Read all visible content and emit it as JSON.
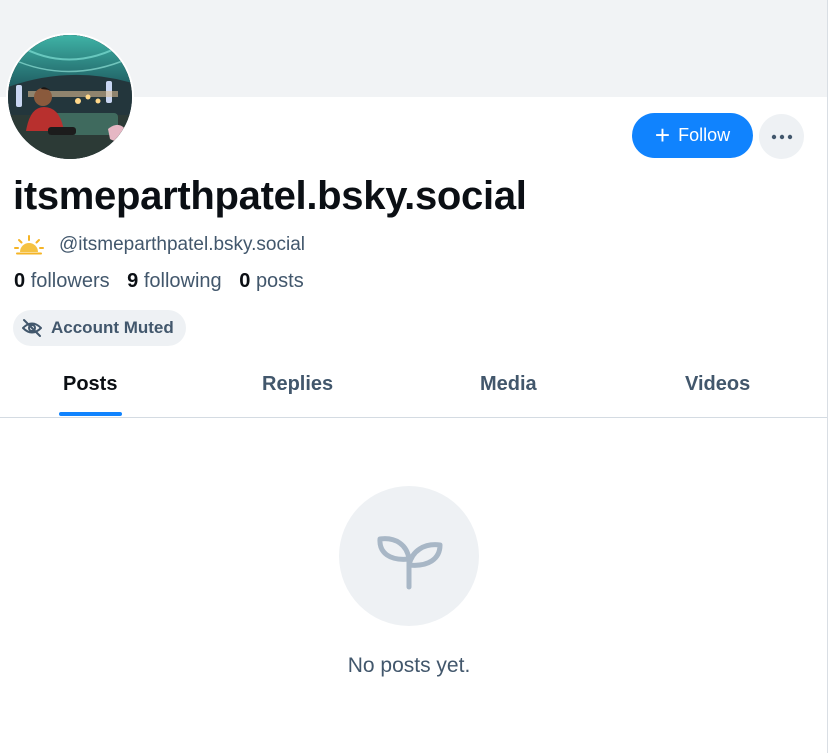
{
  "profile": {
    "display_name": "itsmeparthpatel.bsky.social",
    "handle": "@itsmeparthpatel.bsky.social",
    "avatar_icon": "profile-photo",
    "status_icon": "sun-icon",
    "stats": {
      "followers_count": "0",
      "followers_label": "followers",
      "following_count": "9",
      "following_label": "following",
      "posts_count": "0",
      "posts_label": "posts"
    },
    "muted_badge": {
      "label": "Account Muted",
      "icon": "eye-slash-icon"
    }
  },
  "actions": {
    "follow_label": "Follow",
    "follow_icon": "plus-icon",
    "more_icon": "ellipsis-icon"
  },
  "tabs": [
    {
      "label": "Posts",
      "active": true
    },
    {
      "label": "Replies",
      "active": false
    },
    {
      "label": "Media",
      "active": false
    },
    {
      "label": "Videos",
      "active": false
    }
  ],
  "empty_state": {
    "icon": "seedling-icon",
    "message": "No posts yet."
  },
  "colors": {
    "accent": "#1083fe",
    "muted_text": "#42576c",
    "surface": "#eef1f4",
    "banner": "#f1f3f5"
  }
}
